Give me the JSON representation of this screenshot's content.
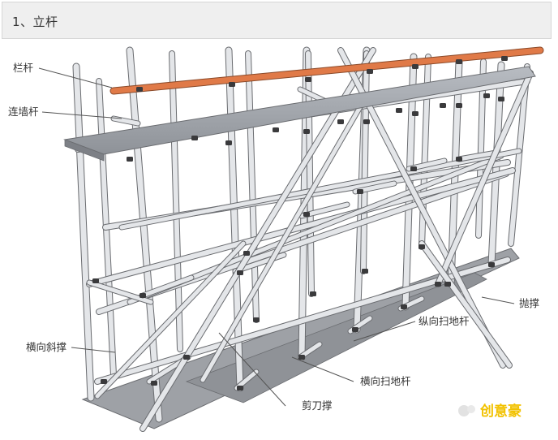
{
  "header": {
    "title": "1、立杆"
  },
  "labels": {
    "guardrail": "栏杆",
    "wall_tie": "连墙杆",
    "longitudinal_brace": "横向斜撑",
    "scissor_brace": "剪刀撑",
    "transverse_sweep_pole": "横向扫地杆",
    "longitudinal_sweep_pole": "纵向扫地杆",
    "throw_brace": "抛撑"
  },
  "watermark": {
    "text": "创意豪"
  },
  "colors": {
    "pipe": "#e4e6e9",
    "pipe_outline": "#6a6c70",
    "guardrail": "#e07a48",
    "coupler": "#3a3a3c",
    "walk_board": "#a9adb3",
    "base_board": "#9a9ca0",
    "watermark": "#f2c200"
  }
}
